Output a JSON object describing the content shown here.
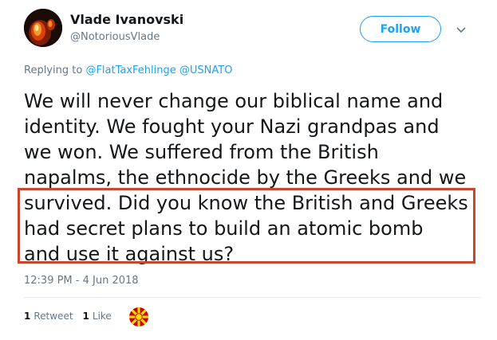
{
  "user": {
    "display_name": "Vlade Ivanovski",
    "handle": "@NotoriousVlade"
  },
  "follow_button_label": "Follow",
  "reply": {
    "prefix": "Replying to",
    "mentions": [
      "@FlatTaxFehlinge",
      "@USNATO"
    ]
  },
  "tweet": {
    "lines": [
      "We will never change our biblical name and",
      "identity. We fought your Nazi grandpas and",
      "we won. We suffered from the British",
      "napalms, the ethnocide by the Greeks and we",
      "survived. Did you know the British and Greeks",
      "had secret plans to build an atomic bomb",
      "and use it against us?"
    ]
  },
  "timestamp": "12:39 PM - 4 Jun 2018",
  "stats": {
    "retweets_count": "1",
    "retweets_label": "Retweet",
    "likes_count": "1",
    "likes_label": "Like"
  },
  "icons": {
    "caret": "chevron-down-icon",
    "liker_avatar": "macedonian-flag-avatar"
  },
  "colors": {
    "accent": "#1da1f2",
    "highlight_border": "#c8472f",
    "secondary_text": "#657786"
  }
}
